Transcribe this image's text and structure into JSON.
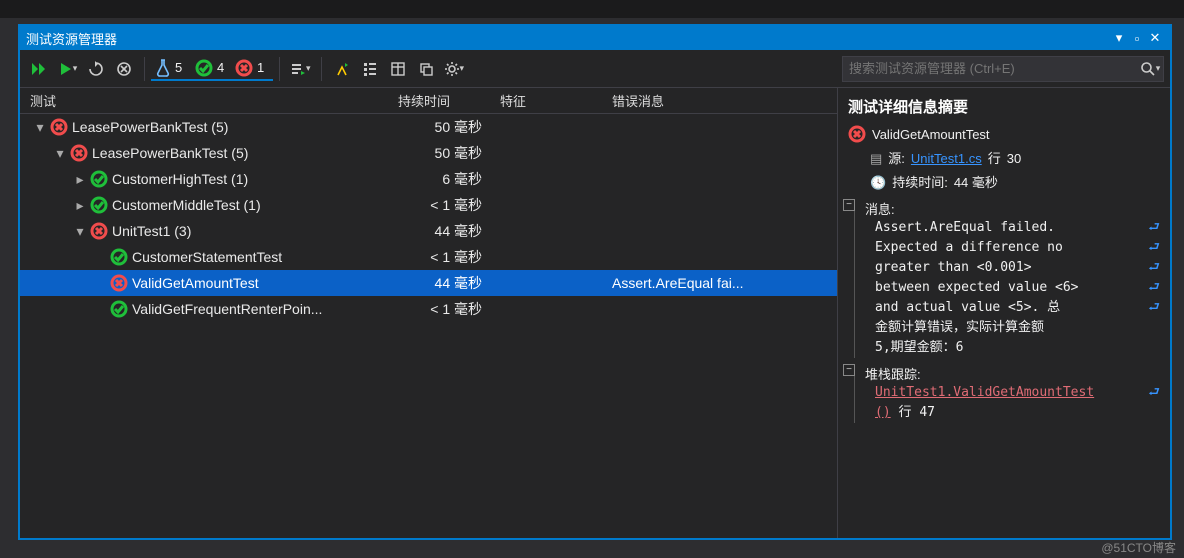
{
  "window": {
    "title": "测试资源管理器"
  },
  "toolbar": {
    "total": "5",
    "passed": "4",
    "failed": "1"
  },
  "search": {
    "placeholder": "搜索测试资源管理器 (Ctrl+E)"
  },
  "columns": {
    "test": "测试",
    "duration": "持续时间",
    "attr": "特征",
    "error": "错误消息"
  },
  "rows": [
    {
      "indent": 0,
      "exp": "▾",
      "status": "fail",
      "name": "LeasePowerBankTest (5)",
      "duration": "50 毫秒",
      "error": "",
      "selected": false
    },
    {
      "indent": 1,
      "exp": "▾",
      "status": "fail",
      "name": "LeasePowerBankTest (5)",
      "duration": "50 毫秒",
      "error": "",
      "selected": false
    },
    {
      "indent": 2,
      "exp": "▸",
      "status": "pass",
      "name": "CustomerHighTest (1)",
      "duration": "6 毫秒",
      "error": "",
      "selected": false
    },
    {
      "indent": 2,
      "exp": "▸",
      "status": "pass",
      "name": "CustomerMiddleTest (1)",
      "duration": "< 1 毫秒",
      "error": "",
      "selected": false
    },
    {
      "indent": 2,
      "exp": "▾",
      "status": "fail",
      "name": "UnitTest1 (3)",
      "duration": "44 毫秒",
      "error": "",
      "selected": false
    },
    {
      "indent": 3,
      "exp": "",
      "status": "pass",
      "name": "CustomerStatementTest",
      "duration": "< 1 毫秒",
      "error": "",
      "selected": false
    },
    {
      "indent": 3,
      "exp": "",
      "status": "fail",
      "name": "ValidGetAmountTest",
      "duration": "44 毫秒",
      "error": "Assert.AreEqual fai...",
      "selected": true
    },
    {
      "indent": 3,
      "exp": "",
      "status": "pass",
      "name": "ValidGetFrequentRenterPoin...",
      "duration": "< 1 毫秒",
      "error": "",
      "selected": false
    }
  ],
  "detail": {
    "title": "测试详细信息摘要",
    "test_name": "ValidGetAmountTest",
    "source_label": "源:",
    "source_file": "UnitTest1.cs",
    "source_line_label": "行",
    "source_line": "30",
    "duration_label": "持续时间:",
    "duration_value": "44 毫秒",
    "message_label": "消息:",
    "message_lines": [
      "Assert.AreEqual failed.",
      " Expected a difference no",
      " greater than <0.001>",
      " between expected value <6>",
      "  and actual value <5>. 总",
      "金额计算错误，实际计算金额",
      "5,期望金额：6"
    ],
    "stack_label": "堆栈跟踪:",
    "stack_link": "UnitTest1.ValidGetAmountTest",
    "stack_link2": "()",
    "stack_line_label": "行",
    "stack_line": "47"
  },
  "watermark": "@51CTO博客"
}
